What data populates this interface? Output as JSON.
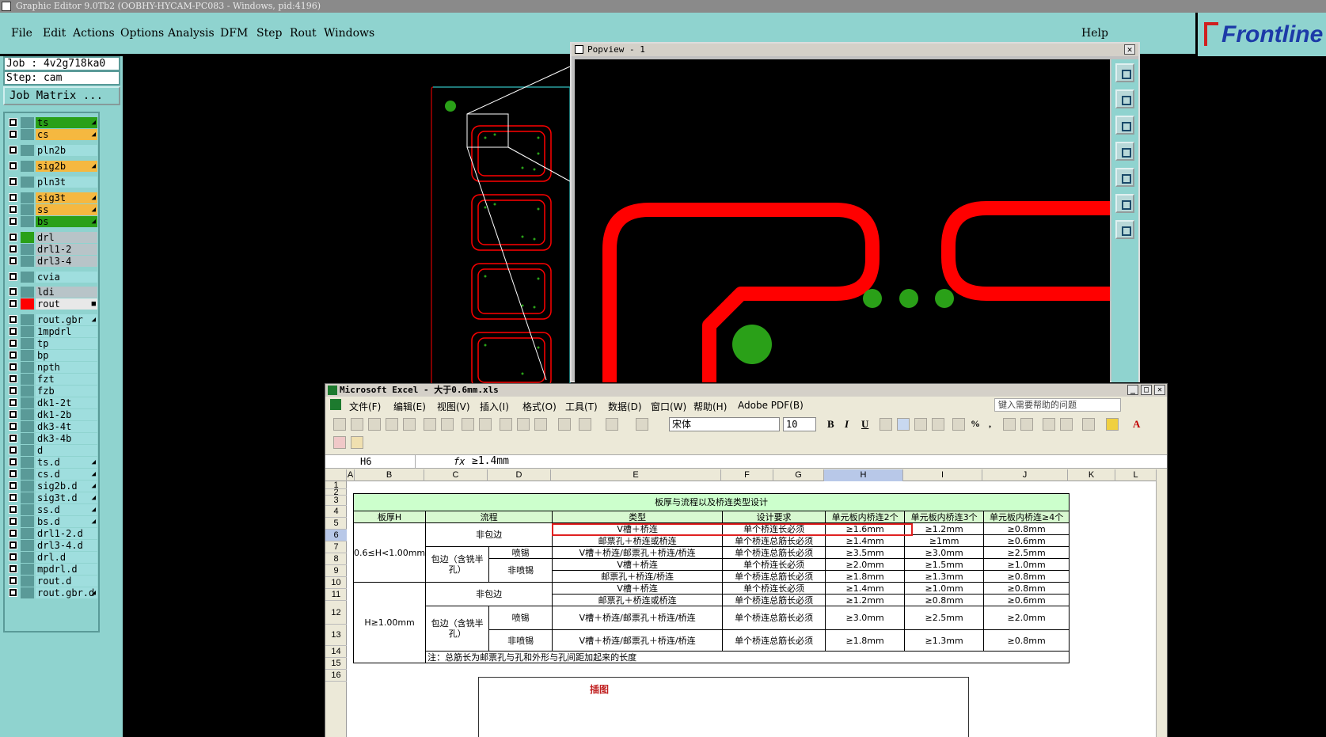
{
  "app": {
    "title": "Graphic Editor 9.0Tb2 (OOBHY-HYCAM-PC083 - Windows, pid:4196)",
    "brand": "Frontline"
  },
  "menu": [
    "File",
    "Edit",
    "Actions",
    "Options",
    "Analysis",
    "DFM",
    "Step",
    "Rout",
    "Windows"
  ],
  "help": "Help",
  "job": {
    "job_label": "Job : 4v2g718ka0",
    "step_label": "Step: cam",
    "matrix_button": "Job Matrix ..."
  },
  "layers": [
    {
      "name": "ts",
      "style": "g2",
      "tag": "◢"
    },
    {
      "name": "cs",
      "style": "y",
      "tag": "◢"
    },
    {
      "name": "pln2b",
      "style": "c",
      "tag": ""
    },
    {
      "name": "sig2b",
      "style": "y",
      "tag": "◢"
    },
    {
      "name": "pln3t",
      "style": "c",
      "tag": ""
    },
    {
      "name": "sig3t",
      "style": "y",
      "tag": "◢"
    },
    {
      "name": "ss",
      "style": "y",
      "tag": "◢"
    },
    {
      "name": "bs",
      "style": "g2",
      "tag": "◢"
    },
    {
      "name": "drl",
      "style": "g",
      "tag": ""
    },
    {
      "name": "drl1-2",
      "style": "g",
      "tag": ""
    },
    {
      "name": "drl3-4",
      "style": "g",
      "tag": ""
    },
    {
      "name": "cvia",
      "style": "c",
      "tag": ""
    },
    {
      "name": "ldi",
      "style": "g",
      "tag": ""
    },
    {
      "name": "rout",
      "style": "w",
      "tag": "■"
    },
    {
      "name": "rout.gbr",
      "style": "c",
      "tag": "◢"
    },
    {
      "name": "1mpdrl",
      "style": "c",
      "tag": ""
    },
    {
      "name": "tp",
      "style": "c",
      "tag": ""
    },
    {
      "name": "bp",
      "style": "c",
      "tag": ""
    },
    {
      "name": "npth",
      "style": "c",
      "tag": ""
    },
    {
      "name": "fzt",
      "style": "c",
      "tag": ""
    },
    {
      "name": "fzb",
      "style": "c",
      "tag": ""
    },
    {
      "name": "dk1-2t",
      "style": "c",
      "tag": ""
    },
    {
      "name": "dk1-2b",
      "style": "c",
      "tag": ""
    },
    {
      "name": "dk3-4t",
      "style": "c",
      "tag": ""
    },
    {
      "name": "dk3-4b",
      "style": "c",
      "tag": ""
    },
    {
      "name": "d",
      "style": "c",
      "tag": ""
    },
    {
      "name": "ts.d",
      "style": "c",
      "tag": "◢"
    },
    {
      "name": "cs.d",
      "style": "c",
      "tag": "◢"
    },
    {
      "name": "sig2b.d",
      "style": "c",
      "tag": "◢"
    },
    {
      "name": "sig3t.d",
      "style": "c",
      "tag": "◢"
    },
    {
      "name": "ss.d",
      "style": "c",
      "tag": "◢"
    },
    {
      "name": "bs.d",
      "style": "c",
      "tag": "◢"
    },
    {
      "name": "drl1-2.d",
      "style": "c",
      "tag": ""
    },
    {
      "name": "drl3-4.d",
      "style": "c",
      "tag": ""
    },
    {
      "name": "drl.d",
      "style": "c",
      "tag": ""
    },
    {
      "name": "mpdrl.d",
      "style": "c",
      "tag": ""
    },
    {
      "name": "rout.d",
      "style": "c",
      "tag": ""
    },
    {
      "name": "rout.gbr.d",
      "style": "c",
      "tag": "◢"
    }
  ],
  "popview": {
    "title": "Popview - 1"
  },
  "excel": {
    "title": "Microsoft Excel - 大于0.6mm.xls",
    "menu": [
      "文件(F)",
      "编辑(E)",
      "视图(V)",
      "插入(I)",
      "格式(O)",
      "工具(T)",
      "数据(D)",
      "窗口(W)",
      "帮助(H)",
      "Adobe PDF(B)"
    ],
    "help_box": "键入需要帮助的问题",
    "font": "宋体",
    "size": "10",
    "cell_ref": "H6",
    "formula": "≥1.4mm",
    "columns": [
      "A",
      "B",
      "C",
      "D",
      "E",
      "F",
      "G",
      "H",
      "I",
      "J",
      "K",
      "L"
    ],
    "rows": [
      "1",
      "2",
      "3",
      "4",
      "5",
      "6",
      "7",
      "8",
      "9",
      "10",
      "11",
      "12",
      "13",
      "14",
      "15",
      "16"
    ],
    "table": {
      "title": "板厚与流程以及桥连类型设计",
      "headers": [
        "板厚H",
        "流程",
        "类型",
        "设计要求",
        "单元板内桥连2个",
        "单元板内桥连3个",
        "单元板内桥连≥4个"
      ],
      "band1": "0.6≤H<1.00mm",
      "band2": "H≥1.00mm",
      "non_wrap": "非包边",
      "wrap": "包边（含铣半孔）",
      "spray": "喷锡",
      "no_spray": "非喷锡",
      "rows": [
        [
          "V槽＋桥连",
          "单个桥连长必须",
          "≥1.6mm",
          "≥1.2mm",
          "≥0.8mm"
        ],
        [
          "邮票孔＋桥连或桥连",
          "单个桥连总筋长必须",
          "≥1.4mm",
          "≥1mm",
          "≥0.6mm"
        ],
        [
          "V槽＋桥连/邮票孔＋桥连/桥连",
          "单个桥连总筋长必须",
          "≥3.5mm",
          "≥3.0mm",
          "≥2.5mm"
        ],
        [
          "V槽＋桥连",
          "单个桥连长必须",
          "≥2.0mm",
          "≥1.5mm",
          "≥1.0mm"
        ],
        [
          "邮票孔＋桥连/桥连",
          "单个桥连总筋长必须",
          "≥1.8mm",
          "≥1.3mm",
          "≥0.8mm"
        ],
        [
          "V槽＋桥连",
          "单个桥连长必须",
          "≥1.4mm",
          "≥1.0mm",
          "≥0.8mm"
        ],
        [
          "邮票孔＋桥连或桥连",
          "单个桥连总筋长必须",
          "≥1.2mm",
          "≥0.8mm",
          "≥0.6mm"
        ],
        [
          "V槽＋桥连/邮票孔＋桥连/桥连",
          "单个桥连总筋长必须",
          "≥3.0mm",
          "≥2.5mm",
          "≥2.0mm"
        ],
        [
          "V槽＋桥连/邮票孔＋桥连/桥连",
          "单个桥连总筋长必须",
          "≥1.8mm",
          "≥1.3mm",
          "≥0.8mm"
        ]
      ],
      "note": "注：总筋长为邮票孔与孔和外形与孔间距加起来的长度"
    },
    "inserted_label": "插图"
  },
  "colors": {
    "teal": "#8fd3cf",
    "layer_yellow": "#f5b840",
    "pcb_red": "#ff0000",
    "pcb_green": "#2aa018",
    "header_green": "#ccffcc"
  }
}
